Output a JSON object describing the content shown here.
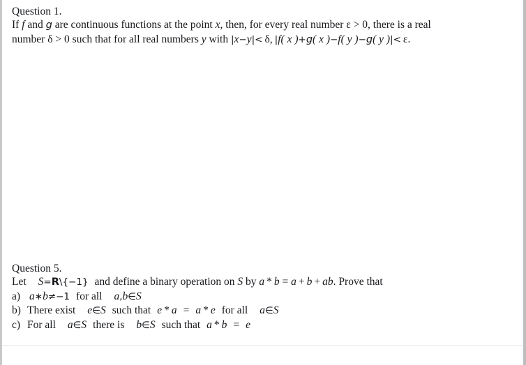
{
  "document": {
    "page_background": "#ffffff",
    "text_color": "#16181c",
    "border_color": "#c9c9c9"
  },
  "question1": {
    "heading": "Question 1.",
    "line1": {
      "t1": "If ",
      "f": "f",
      "t2": " and ",
      "g": "g",
      "t3": " are continuous functions at the point ",
      "x": "x",
      "t4": ", then, for every real number ",
      "eps": "ε",
      "t5": " > 0, there is a real"
    },
    "line2": {
      "t1": "number ",
      "delta": "δ",
      "t2": " > 0 such that for all real numbers ",
      "y": "y",
      "t3": " with ",
      "bar1": "|",
      "x1": "x",
      "minus1": "−",
      "y1": "y",
      "bar2": "|",
      "lt1": "<",
      "delta2": "δ",
      "comma": ",",
      "bar3": "|",
      "f1": "f",
      "px1": "( x )",
      "plus": "+",
      "g1": "g",
      "px2": "( x )",
      "minus2": "−",
      "f2": "f",
      "py1": "( y )",
      "minus3": "−",
      "g2": "g",
      "py2": "( y )",
      "bar4": "|",
      "lt2": "<",
      "eps2": "ε",
      "period": "."
    }
  },
  "question5": {
    "heading": "Question 5.",
    "line1": {
      "let": "Let",
      "S": "S",
      "eq": "=",
      "R": "R",
      "setminus": "\\",
      "brace_open": "{",
      "minus_one": "−1",
      "brace_close": "}",
      "t1": "and define a binary operation on ",
      "S2": "S",
      "t2": " by ",
      "a1": "a",
      "star1": "*",
      "b1": "b",
      "t3": " = ",
      "a2": "a",
      "plus1": "+",
      "b2": "b",
      "plus2": "+",
      "ab": "ab",
      "t4": ". Prove that"
    },
    "items": [
      {
        "marker": "a)",
        "a": "a",
        "star": "∗",
        "b": "b",
        "neq": "≠",
        "minus_one": "−1",
        "forall": "for all",
        "a2": "a",
        "comma": ",",
        "b2": "b",
        "in": "∈",
        "S": "S"
      },
      {
        "marker": "b)",
        "lead": "There exist",
        "e": "e",
        "in1": "∈",
        "S1": "S",
        "such": "such that",
        "e2": "e",
        "star1": "*",
        "a1": "a",
        "eq": "=",
        "a2": "a",
        "star2": "*",
        "e3": "e",
        "forall": "for all",
        "a3": "a",
        "in2": "∈",
        "S2": "S"
      },
      {
        "marker": "c)",
        "lead": "For all",
        "a1": "a",
        "in1": "∈",
        "S1": "S",
        "mid": "there is",
        "b1": "b",
        "in2": "∈",
        "S2": "S",
        "such": "such that",
        "a2": "a",
        "star": "*",
        "b2": "b",
        "eq": "=",
        "e": "e"
      }
    ]
  }
}
